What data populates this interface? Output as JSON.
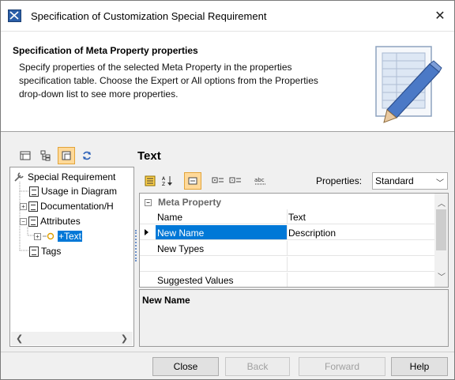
{
  "window": {
    "title": "Specification of Customization Special Requirement"
  },
  "header": {
    "title": "Specification of Meta Property properties",
    "description_lines": [
      "Specify properties of the selected Meta Property in the properties",
      "specification table. Choose the Expert or All options from the Properties",
      "drop-down list to see more properties."
    ]
  },
  "panel": {
    "title": "Text"
  },
  "tree": {
    "items": [
      {
        "label": "Special Requirement"
      },
      {
        "label": "Usage in Diagram"
      },
      {
        "label": "Documentation/H"
      },
      {
        "label": "Attributes"
      },
      {
        "label": "+Text"
      },
      {
        "label": "Tags"
      }
    ]
  },
  "properties": {
    "label": "Properties:",
    "selected": "Standard",
    "group": "Meta Property",
    "rows": [
      {
        "name": "Name",
        "value": "Text"
      },
      {
        "name": "New Name",
        "value": "Description"
      },
      {
        "name": "New Types",
        "value": ""
      },
      {
        "name": "",
        "value": ""
      },
      {
        "name": "Suggested Values",
        "value": ""
      }
    ]
  },
  "description_panel": {
    "title": "New Name"
  },
  "buttons": {
    "close": "Close",
    "back": "Back",
    "forward": "Forward",
    "help": "Help"
  }
}
